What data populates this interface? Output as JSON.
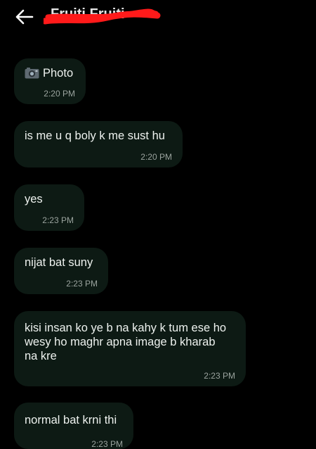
{
  "header": {
    "back_icon": "arrow-left-icon",
    "contact_name": "Fruiti Fruiti"
  },
  "messages": [
    {
      "icon": "camera-icon",
      "text": "Photo",
      "time": "2:20 PM"
    },
    {
      "text": "is me u q boly k me sust hu",
      "time": "2:20 PM"
    },
    {
      "text": "yes",
      "time": "2:23 PM"
    },
    {
      "text": "nijat bat suny",
      "time": "2:23 PM"
    },
    {
      "text": "kisi insan ko ye b na kahy k tum ese ho\nwesy ho maghr apna image b kharab\nna kre",
      "time": "2:23 PM"
    },
    {
      "text": "normal bat krni thi",
      "time": "2:23 PM"
    }
  ],
  "colors": {
    "background": "#000000",
    "bubble": "#0d1a14",
    "text": "#eef2ef",
    "timestamp": "#9aa39e",
    "redaction": "#ff1a1a"
  }
}
